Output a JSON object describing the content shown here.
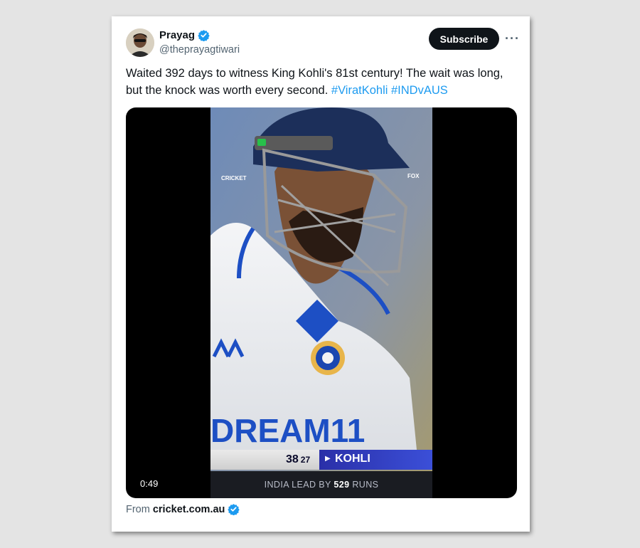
{
  "user": {
    "name": "Prayag",
    "handle": "@theprayagtiwari",
    "verified_color": "#1d9bf0"
  },
  "actions": {
    "subscribe_label": "Subscribe",
    "more_label": "···"
  },
  "tweet": {
    "text": "Waited 392 days to witness King Kohli's 81st century! The wait was long, but the knock was worth every second.",
    "hashtags": [
      "#ViratKohli",
      "#INDvAUS"
    ]
  },
  "video": {
    "duration": "0:49",
    "broadcaster_left": "CRICKET",
    "broadcaster_right": "FOX",
    "jersey_text": "DREAM11",
    "score": {
      "runs": "38",
      "balls": "27",
      "batter": "KOHLI",
      "lead_prefix": "INDIA LEAD BY",
      "lead_runs": "529",
      "lead_suffix": "RUNS"
    }
  },
  "source": {
    "from_label": "From",
    "site": "cricket.com.au"
  },
  "colors": {
    "accent": "#1d9bf0",
    "button_bg": "#0f1419"
  }
}
